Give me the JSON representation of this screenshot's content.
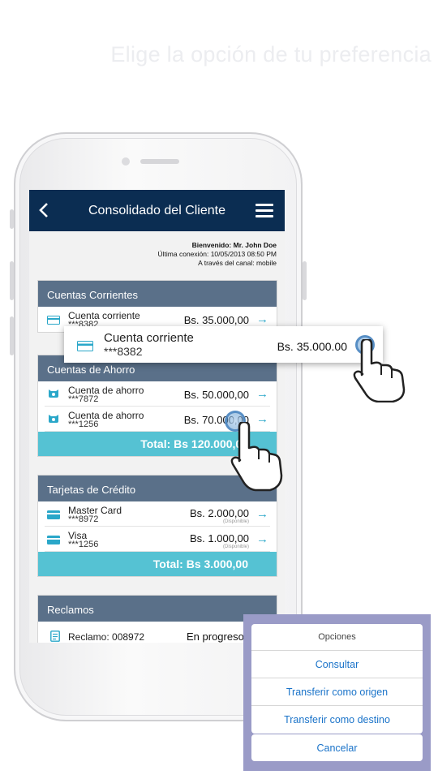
{
  "headline": "Elige la opción de tu preferencia",
  "app": {
    "title": "Consolidado del Cliente",
    "welcome": {
      "name": "Bienvenido: Mr. John Doe",
      "last_login": "Última conexión: 10/05/2013 08:50 PM",
      "channel": "A través del canal: mobile"
    }
  },
  "sections": {
    "corrientes": {
      "title": "Cuentas Corrientes",
      "rows": [
        {
          "label": "Cuenta corriente",
          "number": "***8382",
          "amount": "Bs. 35.000,00",
          "arrow": "→"
        }
      ]
    },
    "ahorro": {
      "title": "Cuentas de Ahorro",
      "rows": [
        {
          "label": "Cuenta de ahorro",
          "number": "***7872",
          "amount": "Bs. 50.000,00",
          "arrow": "→"
        },
        {
          "label": "Cuenta de ahorro",
          "number": "***1256",
          "amount": "Bs. 70.000,00",
          "arrow": "→"
        }
      ],
      "total": "Total:  Bs 120.000,00"
    },
    "tarjetas": {
      "title": "Tarjetas de Crédito",
      "rows": [
        {
          "label": "Master Card",
          "number": "***8972",
          "amount": "Bs. 2.000,00",
          "sub": "(Disponible)",
          "arrow": "→"
        },
        {
          "label": "Visa",
          "number": "***1256",
          "amount": "Bs. 1.000,00",
          "sub": "(Disponible)",
          "arrow": "→"
        }
      ],
      "total": "Total:  Bs 3.000,00"
    },
    "reclamos": {
      "title": "Reclamos",
      "rows": [
        {
          "label": "Reclamo: 008972",
          "status": "En progreso"
        }
      ]
    }
  },
  "popup": {
    "label": "Cuenta corriente",
    "number": "***8382",
    "amount": "Bs. 35.000.00"
  },
  "sheet": {
    "title": "Opciones",
    "options": [
      "Consultar",
      "Transferir como origen",
      "Transferir como destino"
    ],
    "cancel": "Cancelar"
  },
  "colors": {
    "navbar": "#0b2d52",
    "section_header": "#5a7089",
    "total_bar": "#55c2d3",
    "link": "#1a73c9",
    "sheet_bg": "#9a9bc7"
  }
}
